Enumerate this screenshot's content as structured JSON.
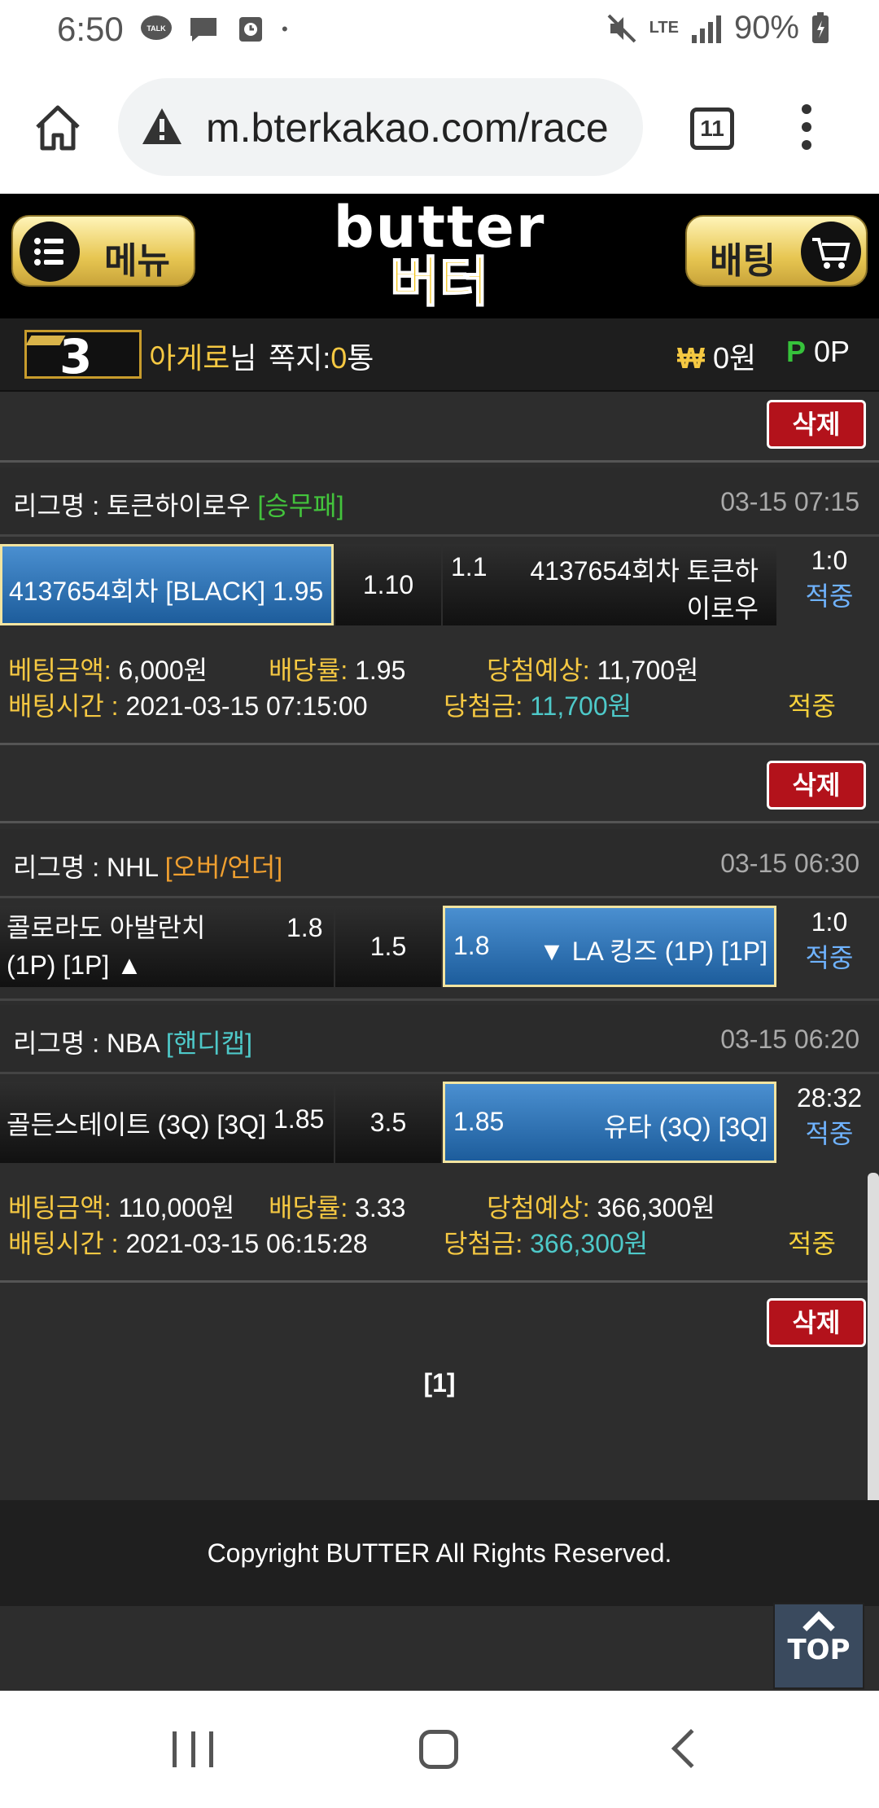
{
  "status_bar": {
    "time": "6:50",
    "notif_icons": [
      "talk-icon",
      "chat-bubble-icon",
      "clock-app-icon",
      "dot-icon"
    ],
    "talk_label": "TALK",
    "dot": "•",
    "network": "LTE",
    "battery": "90%"
  },
  "browser": {
    "url": "m.bterkakao.com/race",
    "tab_count": "11"
  },
  "header": {
    "menu_label": "메뉴",
    "logo_en": "butter",
    "logo_ko": "버터",
    "bet_label": "배팅"
  },
  "user": {
    "level": "3",
    "name": "아게로",
    "name_suffix": "님",
    "memo_label": "쪽지:",
    "memo_count": "0",
    "memo_unit": "통",
    "money_icon": "₩",
    "money": "0원",
    "point_icon": "P",
    "point": "0P"
  },
  "delete_label": "삭제",
  "bets": [
    {
      "games": [
        {
          "league_label": "리그명 : 토큰하이로우",
          "type": "[승무패]",
          "datetime": "03-15 07:15",
          "home": "4137654회차 [BLACK] 1.95",
          "draw": "1.10",
          "away_odds": "1.1",
          "away": "4137654회차 토큰하이로우",
          "score": "1:0",
          "status": "적중"
        }
      ],
      "info": {
        "amount_label": "베팅금액:",
        "amount": "6,000원",
        "rate_label": "배당률:",
        "rate": "1.95",
        "expected_label": "당첨예상:",
        "expected": "11,700원",
        "time_label": "배팅시간 :",
        "time": "2021-03-15 07:15:00",
        "win_label": "당첨금:",
        "win": "11,700원",
        "status": "적중"
      }
    },
    {
      "games": [
        {
          "league_label": "리그명 : NHL",
          "type": "[오버/언더]",
          "datetime": "03-15 06:30",
          "home": "콜로라도 아발란치 (1P) [1P] ▲",
          "home_odds": "1.8",
          "draw": "1.5",
          "away_odds": "1.8",
          "away": "▼ LA 킹즈 (1P) [1P]",
          "score": "1:0",
          "status": "적중"
        },
        {
          "league_label": "리그명 : NBA",
          "type": "[핸디캡]",
          "datetime": "03-15 06:20",
          "home": "골든스테이트 (3Q) [3Q]",
          "home_odds": "1.85",
          "draw": "3.5",
          "away_odds": "1.85",
          "away": "유타 (3Q) [3Q]",
          "score": "28:32",
          "status": "적중"
        }
      ],
      "info": {
        "amount_label": "베팅금액:",
        "amount": "110,000원",
        "rate_label": "배당률:",
        "rate": "3.33",
        "expected_label": "당첨예상:",
        "expected": "366,300원",
        "time_label": "배팅시간 :",
        "time": "2021-03-15 06:15:28",
        "win_label": "당첨금:",
        "win": "366,300원",
        "status": "적중"
      }
    }
  ],
  "pagination": "[1]",
  "footer": "Copyright BUTTER All Rights Reserved.",
  "top_button": "TOP"
}
